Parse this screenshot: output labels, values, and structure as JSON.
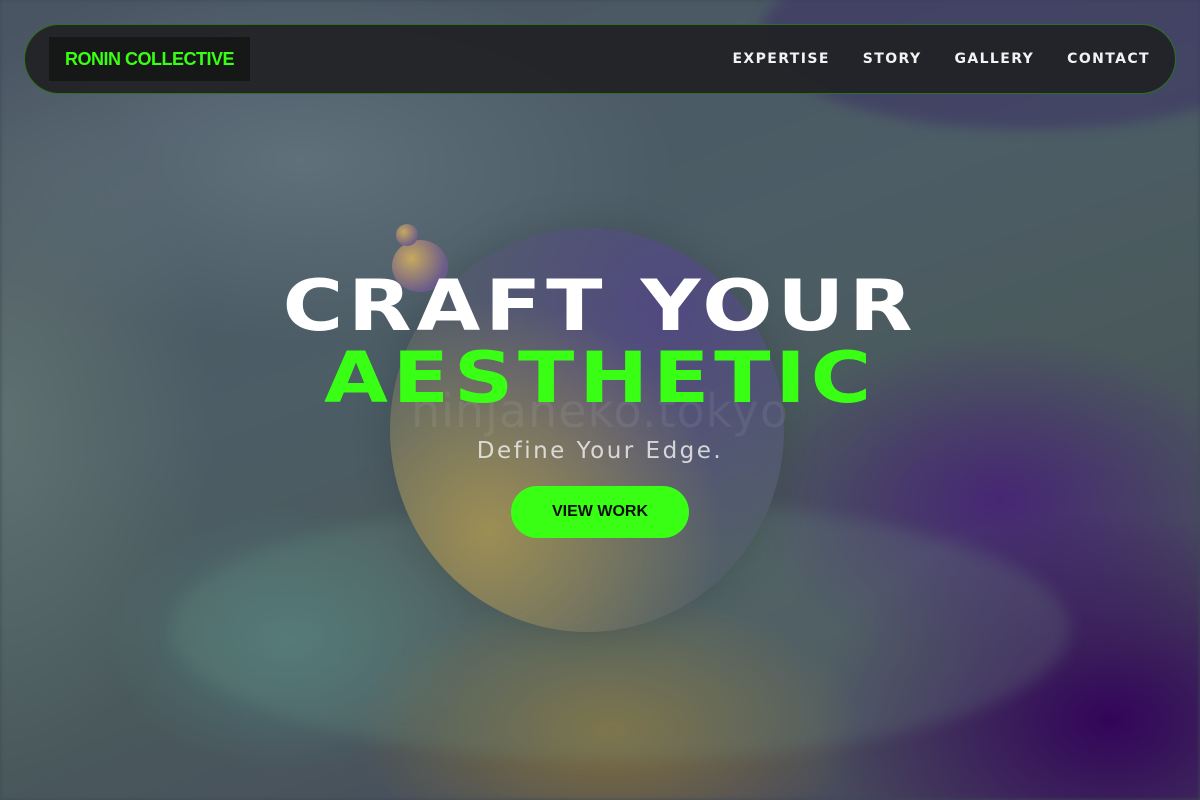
{
  "brand": {
    "name": "RONIN COLLECTIVE"
  },
  "nav": {
    "links": [
      {
        "label": "EXPERTISE"
      },
      {
        "label": "STORY"
      },
      {
        "label": "GALLERY"
      },
      {
        "label": "CONTACT"
      }
    ]
  },
  "hero": {
    "title_line1": "CRAFT YOUR",
    "title_line2": "AESTHETIC",
    "subtitle": "Define Your Edge.",
    "cta_label": "VIEW WORK"
  },
  "watermark": {
    "text": "ninjaneko.tokyo"
  },
  "colors": {
    "accent": "#39ff14",
    "nav_background": "#222326",
    "brand_background": "#161717",
    "text_light": "#ffffff"
  }
}
